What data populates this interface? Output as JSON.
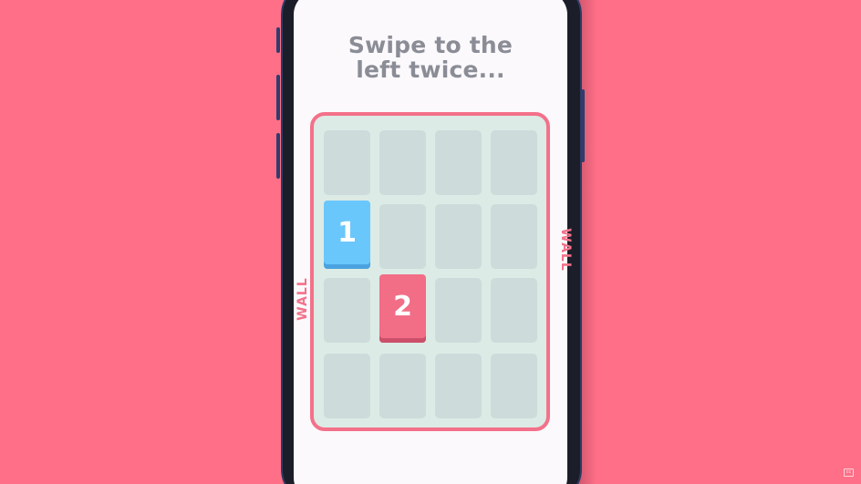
{
  "instruction": {
    "line1": "Swipe to the",
    "line2": "left twice..."
  },
  "board": {
    "rows": 4,
    "cols": 4,
    "tiles": [
      {
        "value": "1",
        "row": 2,
        "col": 1,
        "color": "blue"
      },
      {
        "value": "2",
        "row": 3,
        "col": 2,
        "color": "red"
      }
    ]
  },
  "walls": {
    "left_label": "WALL",
    "right_label": "WALL"
  },
  "colors": {
    "background": "#FF6F87",
    "board_border": "#F3718A",
    "tile_blue": "#6AC7FB",
    "tile_red": "#F26D86",
    "text_gray": "#8B8D96"
  }
}
